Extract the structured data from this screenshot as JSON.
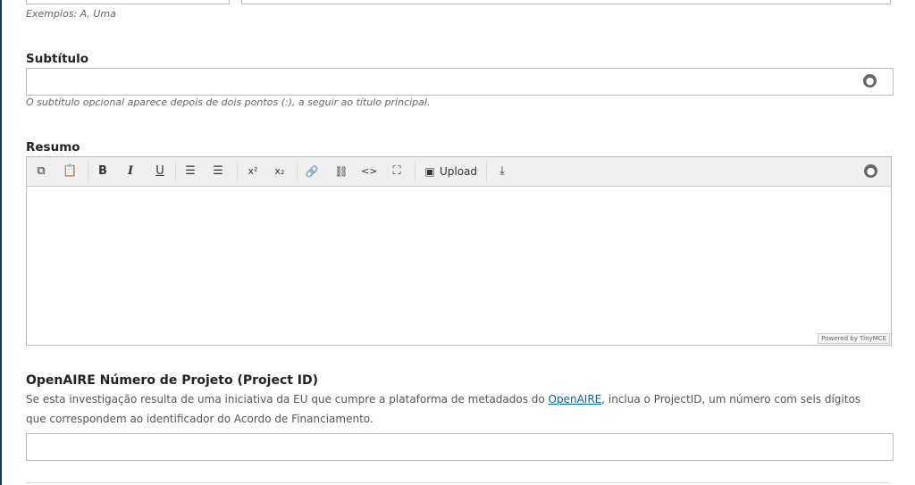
{
  "prefix": {
    "help": "Exemplos: A, Uma"
  },
  "subtitle": {
    "label": "Subtítulo",
    "help": "O subtítulo opcional aparece depois de dois pontos (:), a seguir ao título principal.",
    "value": ""
  },
  "abstract": {
    "label": "Resumo",
    "toolbar": {
      "copy": "⧉",
      "paste": "📋",
      "bold": "B",
      "italic": "I",
      "underline": "U",
      "bullet_list": "☰",
      "numbered_list": "☰",
      "superscript": "x²",
      "subscript": "x₂",
      "link": "🔗",
      "unlink": "⛓",
      "code": "<>",
      "fullscreen": "⛶",
      "image": "▣",
      "upload": "Upload",
      "download": "⤓"
    },
    "powered_by": "Powered by TinyMCE"
  },
  "openaire": {
    "label": "OpenAIRE Número de Projeto (Project ID)",
    "desc_before": "Se esta investigação resulta de uma iniciativa da EU que cumpre a plataforma de metadados do ",
    "link": "OpenAIRE",
    "desc_after": ", inclua o ProjectID, um número com seis dígitos que correspondem ao identificador do Acordo de Financiamento.",
    "value": ""
  },
  "icons": {
    "globe": "globe-icon"
  },
  "colors": {
    "link": "#006798",
    "left_bar": "#1c3a57"
  }
}
